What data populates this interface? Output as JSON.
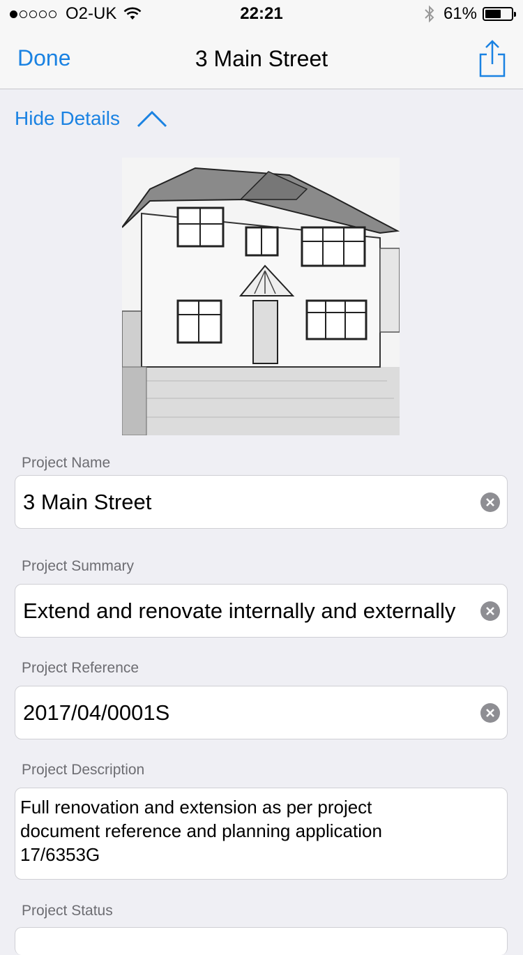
{
  "status_bar": {
    "carrier": "O2-UK",
    "signal_bars_filled": 1,
    "signal_bars_total": 5,
    "time": "22:21",
    "battery_percent": "61%",
    "battery_level": 0.61
  },
  "nav": {
    "done_label": "Done",
    "title": "3 Main Street",
    "share_icon": "share-icon",
    "accent_color": "#1a82e2"
  },
  "details_toggle": {
    "label": "Hide Details",
    "icon": "chevron-up-icon"
  },
  "project": {
    "photo_icon": "house-photo",
    "name_label": "Project Name",
    "name_value": "3 Main Street",
    "summary_label": "Project Summary",
    "summary_value": "Extend and renovate internally and externally",
    "reference_label": "Project Reference",
    "reference_value": "2017/04/0001S",
    "description_label": "Project Description",
    "description_value": "Full renovation and extension as per project document reference and planning application 17/6353G",
    "status_label": "Project Status"
  }
}
